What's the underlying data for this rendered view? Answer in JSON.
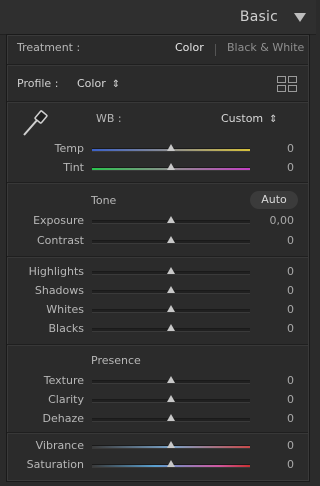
{
  "header": {
    "title": "Basic"
  },
  "treatment": {
    "label": "Treatment :",
    "color": "Color",
    "bw": "Black & White"
  },
  "profile": {
    "label": "Profile :",
    "value": "Color"
  },
  "wb": {
    "label": "WB :",
    "value": "Custom"
  },
  "temp": {
    "label": "Temp",
    "value": "0"
  },
  "tint": {
    "label": "Tint",
    "value": "0"
  },
  "tone": {
    "label": "Tone",
    "auto": "Auto"
  },
  "exposure": {
    "label": "Exposure",
    "value": "0,00"
  },
  "contrast": {
    "label": "Contrast",
    "value": "0"
  },
  "highlights": {
    "label": "Highlights",
    "value": "0"
  },
  "shadows": {
    "label": "Shadows",
    "value": "0"
  },
  "whites": {
    "label": "Whites",
    "value": "0"
  },
  "blacks": {
    "label": "Blacks",
    "value": "0"
  },
  "presence": {
    "label": "Presence"
  },
  "texture": {
    "label": "Texture",
    "value": "0"
  },
  "clarity": {
    "label": "Clarity",
    "value": "0"
  },
  "dehaze": {
    "label": "Dehaze",
    "value": "0"
  },
  "vibrance": {
    "label": "Vibrance",
    "value": "0"
  },
  "saturation": {
    "label": "Saturation",
    "value": "0"
  },
  "sliders": {
    "position": 0.5
  }
}
